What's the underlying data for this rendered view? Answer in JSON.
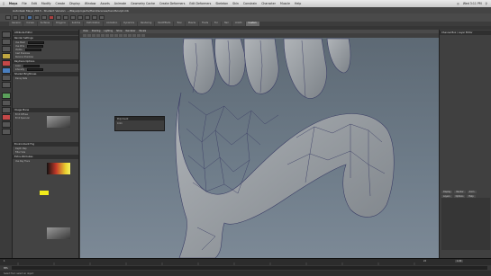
{
  "mac_menu": {
    "apple": "",
    "app": "Maya",
    "items": [
      "File",
      "Edit",
      "Modify",
      "Create",
      "Display",
      "Window",
      "Assets",
      "Animate",
      "Geometry Cache",
      "Create Deformers",
      "Edit Deformers",
      "Skeleton",
      "Skin",
      "Constrain",
      "Character",
      "Muscle",
      "Help"
    ],
    "right_status": "Wed 3:11 PM"
  },
  "title_bar": "Autodesk Maya 2013 - Student Version: ~/Maya/projects/Hand/scenes/handSculpt.mb",
  "shelf_tabs": [
    "General",
    "Curves",
    "Surfaces",
    "Polygons",
    "Subdivs",
    "Deformation",
    "Animation",
    "Dynamics",
    "Rendering",
    "PaintEffects",
    "Toon",
    "Muscle",
    "Fluids",
    "Fur",
    "Hair",
    "nCloth",
    "Custom"
  ],
  "attr_panel": {
    "title": "Attribute Editor",
    "sections": [
      "Render Settings",
      "Raytrace Options",
      "Shaded Brightness",
      "Image Plane",
      "Environment Fog",
      "Extra Attributes"
    ],
    "labels": [
      "Use Mesh",
      "Use Wire",
      "Visible",
      "Cast Shadows",
      "Receive Shadows",
      "Color",
      "Intensity",
      "Decay Rate",
      "Emit Diffuse",
      "Emit Specular",
      "Depth Map",
      "Filter Size",
      "Use Ray Trace"
    ]
  },
  "viewport": {
    "menu": [
      "View",
      "Shading",
      "Lighting",
      "Show",
      "Renderer",
      "Panels"
    ],
    "dialog_title": "Poly Count",
    "dialog_value": "1014"
  },
  "right_panel": {
    "title": "Channel Box / Layer Editor",
    "tabs": [
      "Display",
      "Render",
      "Anim"
    ],
    "layer_tabs": [
      "Layers",
      "Options",
      "Help"
    ]
  },
  "timeline": {
    "start": "1",
    "end": "24",
    "current": "1.00"
  },
  "cmd": {
    "label": "MEL",
    "value": ""
  },
  "help_line": "Select Tool: select an object"
}
